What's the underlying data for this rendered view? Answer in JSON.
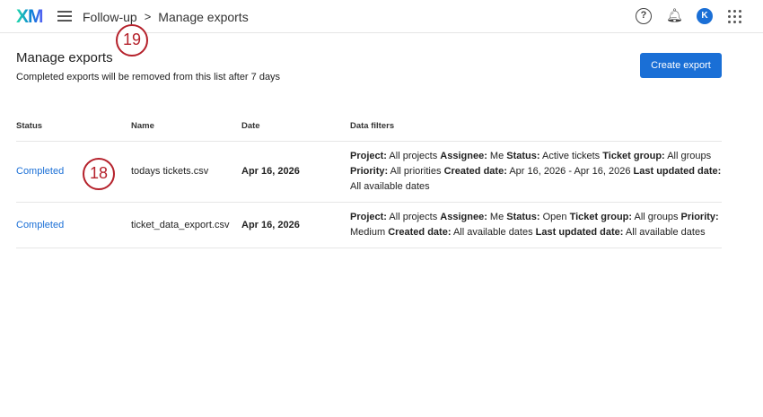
{
  "header": {
    "logo": "XM",
    "breadcrumbs": [
      "Follow-up",
      "Manage exports"
    ],
    "breadcrumb_sep": ">",
    "help_icon": "?",
    "avatar": "K"
  },
  "page": {
    "title": "Manage exports",
    "subtitle": "Completed exports will be removed from this list after 7 days",
    "create_button": "Create export"
  },
  "table": {
    "headers": [
      "Status",
      "Name",
      "Date",
      "Data filters"
    ],
    "rows": [
      {
        "status": "Completed",
        "name": "todays tickets.csv",
        "date": "Apr 16, 2026",
        "filters": [
          {
            "label": "Project:",
            "value": "All projects"
          },
          {
            "label": "Assignee:",
            "value": "Me"
          },
          {
            "label": "Status:",
            "value": "Active tickets"
          },
          {
            "label": "Ticket group:",
            "value": "All groups"
          },
          {
            "label": "Priority:",
            "value": "All priorities"
          },
          {
            "label": "Created date:",
            "value": "Apr 16, 2026 - Apr 16, 2026"
          },
          {
            "label": "Last updated date:",
            "value": "All available dates"
          }
        ]
      },
      {
        "status": "Completed",
        "name": "ticket_data_export.csv",
        "date": "Apr 16, 2026",
        "filters": [
          {
            "label": "Project:",
            "value": "All projects"
          },
          {
            "label": "Assignee:",
            "value": "Me"
          },
          {
            "label": "Status:",
            "value": "Open"
          },
          {
            "label": "Ticket group:",
            "value": "All groups"
          },
          {
            "label": "Priority:",
            "value": "Medium"
          },
          {
            "label": "Created date:",
            "value": "All available dates"
          },
          {
            "label": "Last updated date:",
            "value": "All available dates"
          }
        ]
      }
    ]
  },
  "callouts": [
    "19",
    "18"
  ]
}
